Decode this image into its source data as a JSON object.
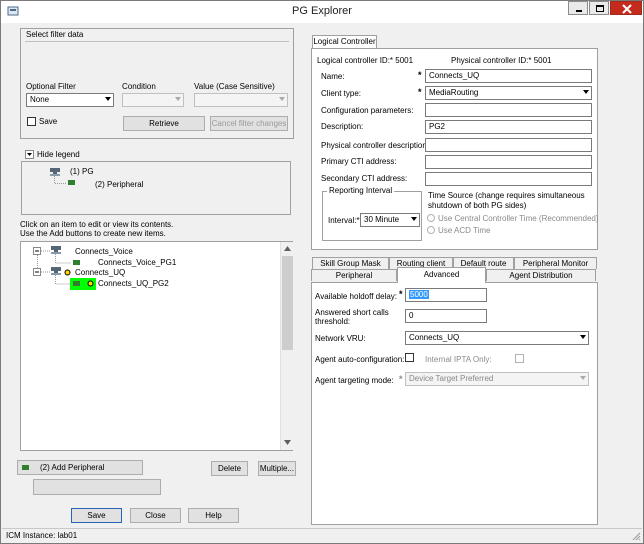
{
  "window": {
    "title": "PG Explorer"
  },
  "filter": {
    "section_title": "Select filter data",
    "optional_filter_label": "Optional Filter",
    "optional_filter_value": "None",
    "condition_label": "Condition",
    "condition_value": "",
    "value_label": "Value (Case Sensitive)",
    "value_value": "",
    "save_label": "Save",
    "retrieve_label": "Retrieve",
    "cancel_filter_label": "Cancel filter changes"
  },
  "legend": {
    "toggle_label": "Hide legend",
    "items": [
      "(1) PG",
      "(2) Peripheral"
    ]
  },
  "instructions": {
    "line1": "Click on an item to edit or view its contents.",
    "line2": "Use the Add buttons to create new items."
  },
  "tree": {
    "nodes": [
      {
        "label": "Connects_Voice",
        "level": 1
      },
      {
        "label": "Connects_Voice_PG1",
        "level": 2
      },
      {
        "label": "Connects_UQ",
        "level": 1
      },
      {
        "label": "Connects_UQ_PG2",
        "level": 2,
        "selected": true
      }
    ]
  },
  "tree_actions": {
    "add_peripheral_label": "(2) Add Peripheral",
    "delete_label": "Delete",
    "multiple_label": "Multiple..."
  },
  "footer": {
    "save_label": "Save",
    "close_label": "Close",
    "help_label": "Help"
  },
  "status": {
    "text": "ICM Instance: lab01"
  },
  "logical_controller": {
    "tab_label": "Logical Controller",
    "logical_id_label": "Logical controller ID:",
    "logical_id_value": "5001",
    "physical_id_label": "Physical controller ID:",
    "physical_id_value": "5001",
    "name_label": "Name:",
    "name_value": "Connects_UQ",
    "client_type_label": "Client type:",
    "client_type_value": "MediaRouting",
    "config_params_label": "Configuration parameters:",
    "config_params_value": "",
    "description_label": "Description:",
    "description_value": "PG2",
    "phys_desc_label": "Physical controller description:",
    "phys_desc_value": "",
    "primary_cti_label": "Primary CTI address:",
    "primary_cti_value": "",
    "secondary_cti_label": "Secondary CTI address:",
    "secondary_cti_value": "",
    "reporting_interval_label": "Reporting Interval",
    "interval_label": "Interval:",
    "interval_value": "30 Minute",
    "time_source_label": "Time Source (change requires simultaneous shutdown of both PG sides)",
    "time_source_option1": "Use Central Controller Time (Recommended)",
    "time_source_option2": "Use ACD Time"
  },
  "peripheral_tabs": {
    "row1": [
      "Skill Group Mask",
      "Routing client",
      "Default route",
      "Peripheral Monitor"
    ],
    "row2": [
      "Peripheral",
      "Advanced",
      "Agent Distribution"
    ],
    "active": "Advanced"
  },
  "advanced": {
    "holdoff_label": "Available holdoff delay:",
    "holdoff_value": "5000",
    "short_calls_label_line1": "Answered short calls",
    "short_calls_label_line2": "threshold:",
    "short_calls_value": "0",
    "network_vru_label": "Network VRU:",
    "network_vru_value": "Connects_UQ",
    "agent_auto_config_label": "Agent auto-configuration:",
    "internal_ipta_label": "Internal IPTA Only:",
    "agent_targeting_label": "Agent targeting mode:",
    "agent_targeting_value": "Device Target Preferred"
  }
}
